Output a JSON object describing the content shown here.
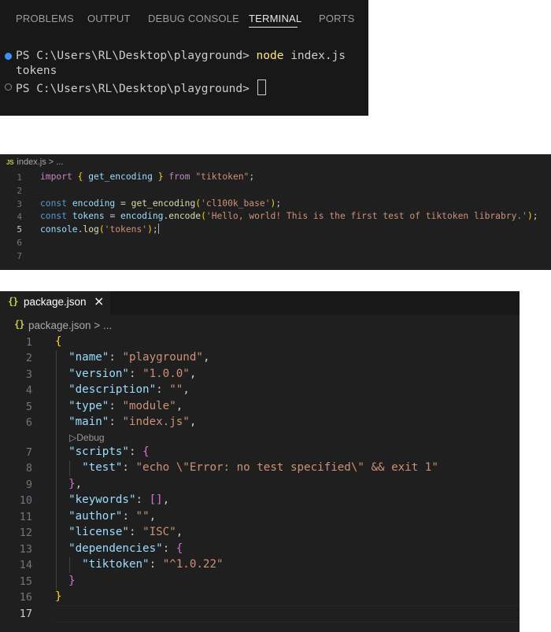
{
  "terminal": {
    "tabs": [
      "PROBLEMS",
      "OUTPUT",
      "DEBUG CONSOLE",
      "TERMINAL",
      "PORTS"
    ],
    "active_tab": "TERMINAL",
    "line1_prompt": "PS C:\\Users\\RL\\Desktop\\playground> ",
    "line1_command": "node",
    "line1_args": " index.js",
    "output": "tokens",
    "line3_prompt": "PS C:\\Users\\RL\\Desktop\\playground> ",
    "colors": {
      "success_dot": "#3794ff",
      "command": "#ffe76b"
    }
  },
  "index_editor": {
    "breadcrumb_badge": "JS",
    "breadcrumb": "index.js > ...",
    "line_numbers": [
      "1",
      "2",
      "3",
      "4",
      "5",
      "6",
      "7"
    ],
    "current_line": "5"
  },
  "package_editor": {
    "tab_icon": "{}",
    "tab_label": "package.json",
    "close_icon": "×",
    "breadcrumb_icon": "{}",
    "breadcrumb": "package.json > ...",
    "codelens": "▷Debug",
    "line_numbers": [
      "1",
      "2",
      "3",
      "4",
      "5",
      "6",
      "7",
      "8",
      "9",
      "10",
      "11",
      "12",
      "13",
      "14",
      "15",
      "16",
      "17"
    ],
    "current_line": "17"
  }
}
